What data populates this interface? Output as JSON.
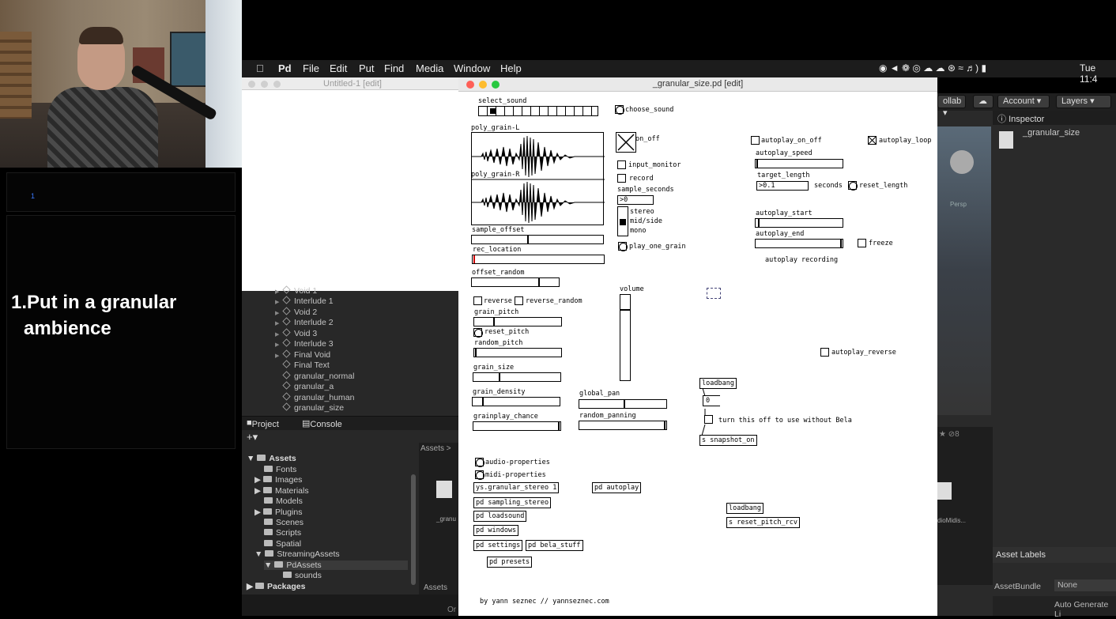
{
  "menubar": {
    "apple": "",
    "app": "Pd",
    "items": [
      "File",
      "Edit",
      "Put",
      "Find",
      "Media",
      "Window",
      "Help"
    ],
    "clock": "Tue 11:4"
  },
  "left_slide": {
    "small_marker": "1",
    "title_line1": "1.Put in a granular",
    "title_line2": "ambience"
  },
  "untitled_window": {
    "title": "Untitled-1 [edit]"
  },
  "pd_window": {
    "title": "_granular_size.pd [edit]"
  },
  "unity": {
    "hierarchy": [
      "Void 1",
      "Interlude 1",
      "Void 2",
      "Interlude 2",
      "Void 3",
      "Interlude 3",
      "Final Void",
      "Final Text",
      "granular_normal",
      "granular_a",
      "granular_human",
      "granular_size"
    ],
    "tabs": {
      "project": "Project",
      "console": "Console"
    },
    "plus": "+▾",
    "assets_root": "Assets",
    "folders": [
      "Fonts",
      "Images",
      "Materials",
      "Models",
      "Plugins",
      "Scenes",
      "Scripts",
      "Spatial",
      "StreamingAssets",
      "PdAssets",
      "sounds",
      "Packages"
    ],
    "assets_breadcrumb": "Assets >",
    "assets_breadcrumb2": "Assets",
    "file_label_left": "_granu",
    "file_label_right": "dioMidis...",
    "toolbar": {
      "collab": "ollab ▾",
      "account": "Account",
      "layers": "Layers"
    },
    "inspector": {
      "header": "Inspector",
      "item": "_granular_size"
    },
    "asset_labels": "Asset Labels",
    "asset_bundle": "AssetBundle",
    "asset_bundle_value": "None",
    "auto_generate": "Auto Generate Li",
    "scene_label": "Persp",
    "count": "8",
    "bottom_label": "Or"
  },
  "pd": {
    "select_sound": "select_sound",
    "choose_sound": "choose_sound",
    "poly_grain_L": "poly_grain-L",
    "poly_grain_R": "poly_grain-R",
    "on_off": "on_off",
    "input_monitor": "input_monitor",
    "record": "record",
    "sample_seconds": "sample_seconds",
    "sample_seconds_val": ">0",
    "stereo": "stereo",
    "mid_side": "mid/side",
    "mono": "mono",
    "play_one_grain": "play_one_grain",
    "sample_offset": "sample_offset",
    "rec_location": "rec_location",
    "offset_random": "offset_random",
    "reverse": "reverse",
    "reverse_random": "reverse_random",
    "grain_pitch": "grain_pitch",
    "reset_pitch": "reset_pitch",
    "random_pitch": "random_pitch",
    "grain_size": "grain_size",
    "grain_density": "grain_density",
    "grainplay_chance": "grainplay_chance",
    "global_pan": "global_pan",
    "random_panning": "random_panning",
    "volume": "volume",
    "autoplay_on_off": "autoplay_on_off",
    "autoplay_loop": "autoplay_loop",
    "autoplay_speed": "autoplay_speed",
    "target_length": "target_length",
    "target_length_val": ">0.1",
    "seconds": "seconds",
    "reset_length": "reset_length",
    "autoplay_start": "autoplay_start",
    "autoplay_end": "autoplay_end",
    "freeze": "freeze",
    "autoplay_recording": "autoplay recording",
    "autoplay_reverse": "autoplay_reverse",
    "loadbang": "loadbang",
    "msg_zero": "0",
    "bela_note": "turn this off to use without Bela",
    "snapshot_on": "s snapshot_on",
    "audio_properties": "audio-properties",
    "midi_properties": "midi-properties",
    "granular_stereo": "ys.granular_stereo 1",
    "pd_autoplay": "pd autoplay",
    "pd_sampling_stereo": "pd sampling_stereo",
    "pd_loadsound": "pd loadsound",
    "pd_windows": "pd windows",
    "pd_settings": "pd settings",
    "pd_bela_stuff": "pd bela_stuff",
    "pd_presets": "pd presets",
    "loadbang2": "loadbang",
    "reset_pitch_rcv": "s reset_pitch_rcv",
    "credit": "by yann seznec // yannseznec.com"
  }
}
